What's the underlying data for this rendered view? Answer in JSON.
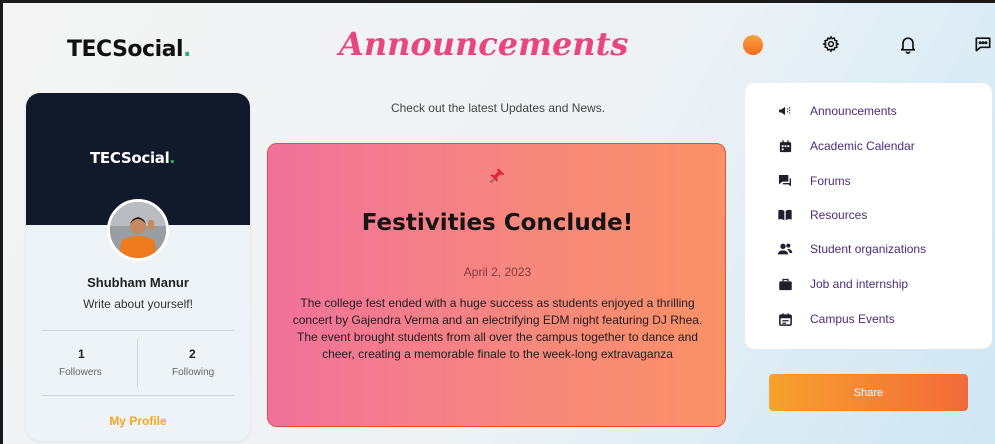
{
  "header": {
    "logo_text": "TECSocial",
    "logo_dot": ".",
    "page_title": "Announcements",
    "icons": [
      "user-avatar",
      "gear-icon",
      "bell-icon",
      "chat-icon"
    ]
  },
  "profile": {
    "banner_logo_text": "TECSocial",
    "banner_logo_dot": ".",
    "name": "Shubham Manur",
    "bio": "Write about yourself!",
    "followers_count": "1",
    "followers_label": "Followers",
    "following_count": "2",
    "following_label": "Following",
    "link_label": "My Profile"
  },
  "main": {
    "subtitle": "Check out the latest Updates and News.",
    "announcement": {
      "title": "Festivities Conclude!",
      "date": "April 2, 2023",
      "body": "The college fest ended with a huge success as students enjoyed a thrilling concert by Gajendra Verma and an electrifying EDM night featuring DJ Rhea. The event brought students from all over the campus together to dance and cheer, creating a memorable finale to the week-long extravaganza"
    }
  },
  "nav": {
    "items": [
      {
        "label": "Announcements",
        "icon": "megaphone-icon"
      },
      {
        "label": "Academic Calendar",
        "icon": "calendar-icon"
      },
      {
        "label": "Forums",
        "icon": "forum-icon"
      },
      {
        "label": "Resources",
        "icon": "book-icon"
      },
      {
        "label": "Student organizations",
        "icon": "group-icon"
      },
      {
        "label": "Job and internship",
        "icon": "briefcase-icon"
      },
      {
        "label": "Campus Events",
        "icon": "event-icon"
      }
    ]
  },
  "share_button_label": "Share",
  "colors": {
    "title_pink": "#e8467c",
    "accent_orange": "#f5a623",
    "nav_text": "#4a2d7a",
    "banner_dark": "#111a2a"
  }
}
